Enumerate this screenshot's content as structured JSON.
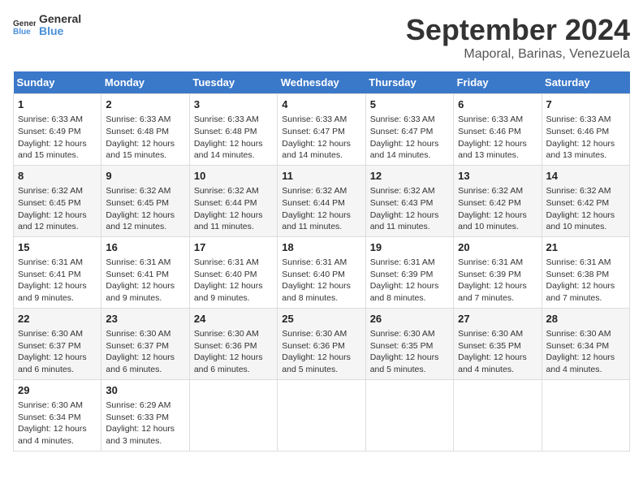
{
  "header": {
    "logo_general": "General",
    "logo_blue": "Blue",
    "month": "September 2024",
    "location": "Maporal, Barinas, Venezuela"
  },
  "days_of_week": [
    "Sunday",
    "Monday",
    "Tuesday",
    "Wednesday",
    "Thursday",
    "Friday",
    "Saturday"
  ],
  "weeks": [
    [
      {
        "day": "1",
        "sunrise": "Sunrise: 6:33 AM",
        "sunset": "Sunset: 6:49 PM",
        "daylight": "Daylight: 12 hours and 15 minutes."
      },
      {
        "day": "2",
        "sunrise": "Sunrise: 6:33 AM",
        "sunset": "Sunset: 6:48 PM",
        "daylight": "Daylight: 12 hours and 15 minutes."
      },
      {
        "day": "3",
        "sunrise": "Sunrise: 6:33 AM",
        "sunset": "Sunset: 6:48 PM",
        "daylight": "Daylight: 12 hours and 14 minutes."
      },
      {
        "day": "4",
        "sunrise": "Sunrise: 6:33 AM",
        "sunset": "Sunset: 6:47 PM",
        "daylight": "Daylight: 12 hours and 14 minutes."
      },
      {
        "day": "5",
        "sunrise": "Sunrise: 6:33 AM",
        "sunset": "Sunset: 6:47 PM",
        "daylight": "Daylight: 12 hours and 14 minutes."
      },
      {
        "day": "6",
        "sunrise": "Sunrise: 6:33 AM",
        "sunset": "Sunset: 6:46 PM",
        "daylight": "Daylight: 12 hours and 13 minutes."
      },
      {
        "day": "7",
        "sunrise": "Sunrise: 6:33 AM",
        "sunset": "Sunset: 6:46 PM",
        "daylight": "Daylight: 12 hours and 13 minutes."
      }
    ],
    [
      {
        "day": "8",
        "sunrise": "Sunrise: 6:32 AM",
        "sunset": "Sunset: 6:45 PM",
        "daylight": "Daylight: 12 hours and 12 minutes."
      },
      {
        "day": "9",
        "sunrise": "Sunrise: 6:32 AM",
        "sunset": "Sunset: 6:45 PM",
        "daylight": "Daylight: 12 hours and 12 minutes."
      },
      {
        "day": "10",
        "sunrise": "Sunrise: 6:32 AM",
        "sunset": "Sunset: 6:44 PM",
        "daylight": "Daylight: 12 hours and 11 minutes."
      },
      {
        "day": "11",
        "sunrise": "Sunrise: 6:32 AM",
        "sunset": "Sunset: 6:44 PM",
        "daylight": "Daylight: 12 hours and 11 minutes."
      },
      {
        "day": "12",
        "sunrise": "Sunrise: 6:32 AM",
        "sunset": "Sunset: 6:43 PM",
        "daylight": "Daylight: 12 hours and 11 minutes."
      },
      {
        "day": "13",
        "sunrise": "Sunrise: 6:32 AM",
        "sunset": "Sunset: 6:42 PM",
        "daylight": "Daylight: 12 hours and 10 minutes."
      },
      {
        "day": "14",
        "sunrise": "Sunrise: 6:32 AM",
        "sunset": "Sunset: 6:42 PM",
        "daylight": "Daylight: 12 hours and 10 minutes."
      }
    ],
    [
      {
        "day": "15",
        "sunrise": "Sunrise: 6:31 AM",
        "sunset": "Sunset: 6:41 PM",
        "daylight": "Daylight: 12 hours and 9 minutes."
      },
      {
        "day": "16",
        "sunrise": "Sunrise: 6:31 AM",
        "sunset": "Sunset: 6:41 PM",
        "daylight": "Daylight: 12 hours and 9 minutes."
      },
      {
        "day": "17",
        "sunrise": "Sunrise: 6:31 AM",
        "sunset": "Sunset: 6:40 PM",
        "daylight": "Daylight: 12 hours and 9 minutes."
      },
      {
        "day": "18",
        "sunrise": "Sunrise: 6:31 AM",
        "sunset": "Sunset: 6:40 PM",
        "daylight": "Daylight: 12 hours and 8 minutes."
      },
      {
        "day": "19",
        "sunrise": "Sunrise: 6:31 AM",
        "sunset": "Sunset: 6:39 PM",
        "daylight": "Daylight: 12 hours and 8 minutes."
      },
      {
        "day": "20",
        "sunrise": "Sunrise: 6:31 AM",
        "sunset": "Sunset: 6:39 PM",
        "daylight": "Daylight: 12 hours and 7 minutes."
      },
      {
        "day": "21",
        "sunrise": "Sunrise: 6:31 AM",
        "sunset": "Sunset: 6:38 PM",
        "daylight": "Daylight: 12 hours and 7 minutes."
      }
    ],
    [
      {
        "day": "22",
        "sunrise": "Sunrise: 6:30 AM",
        "sunset": "Sunset: 6:37 PM",
        "daylight": "Daylight: 12 hours and 6 minutes."
      },
      {
        "day": "23",
        "sunrise": "Sunrise: 6:30 AM",
        "sunset": "Sunset: 6:37 PM",
        "daylight": "Daylight: 12 hours and 6 minutes."
      },
      {
        "day": "24",
        "sunrise": "Sunrise: 6:30 AM",
        "sunset": "Sunset: 6:36 PM",
        "daylight": "Daylight: 12 hours and 6 minutes."
      },
      {
        "day": "25",
        "sunrise": "Sunrise: 6:30 AM",
        "sunset": "Sunset: 6:36 PM",
        "daylight": "Daylight: 12 hours and 5 minutes."
      },
      {
        "day": "26",
        "sunrise": "Sunrise: 6:30 AM",
        "sunset": "Sunset: 6:35 PM",
        "daylight": "Daylight: 12 hours and 5 minutes."
      },
      {
        "day": "27",
        "sunrise": "Sunrise: 6:30 AM",
        "sunset": "Sunset: 6:35 PM",
        "daylight": "Daylight: 12 hours and 4 minutes."
      },
      {
        "day": "28",
        "sunrise": "Sunrise: 6:30 AM",
        "sunset": "Sunset: 6:34 PM",
        "daylight": "Daylight: 12 hours and 4 minutes."
      }
    ],
    [
      {
        "day": "29",
        "sunrise": "Sunrise: 6:30 AM",
        "sunset": "Sunset: 6:34 PM",
        "daylight": "Daylight: 12 hours and 4 minutes."
      },
      {
        "day": "30",
        "sunrise": "Sunrise: 6:29 AM",
        "sunset": "Sunset: 6:33 PM",
        "daylight": "Daylight: 12 hours and 3 minutes."
      },
      null,
      null,
      null,
      null,
      null
    ]
  ]
}
